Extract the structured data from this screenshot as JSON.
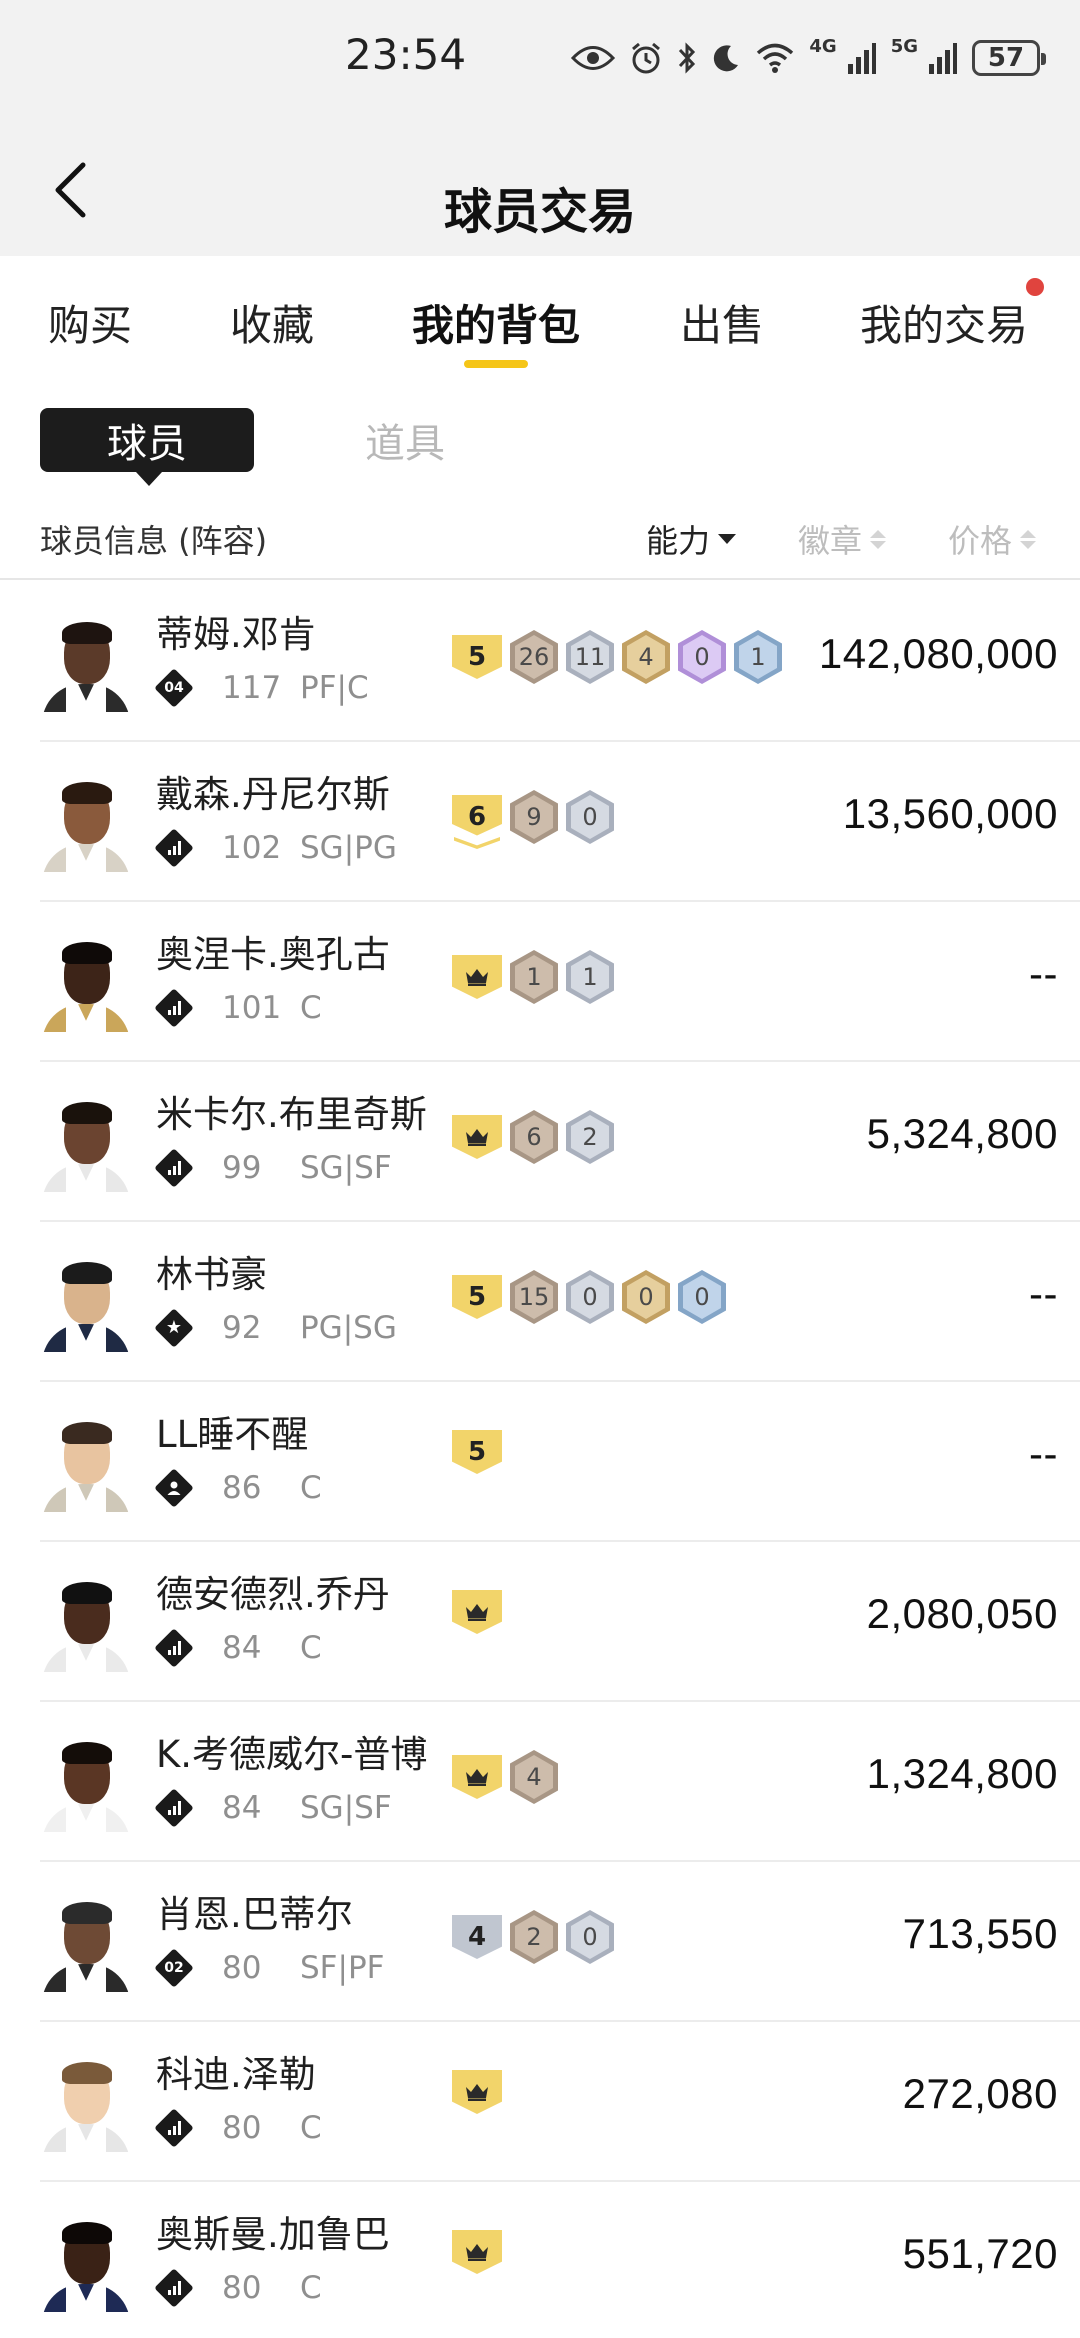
{
  "status_bar": {
    "time": "23:54",
    "net1": "4G",
    "net2": "5G",
    "battery": "57"
  },
  "nav": {
    "title": "球员交易"
  },
  "tabs": [
    {
      "label": "购买"
    },
    {
      "label": "收藏"
    },
    {
      "label": "我的背包"
    },
    {
      "label": "出售"
    },
    {
      "label": "我的交易"
    }
  ],
  "segment": {
    "players": "球员",
    "items": "道具"
  },
  "columns": {
    "info": "球员信息 (阵容)",
    "ability": "能力",
    "badge": "徽章",
    "price": "价格"
  },
  "colors": {
    "accent": "#f5c518",
    "notify_dot": "#e0443e",
    "level_gold": "#f2d46a"
  },
  "players": [
    {
      "name": "蒂姆.邓肯",
      "tier": "04",
      "rating": "117",
      "position": "PF|C",
      "level": "5",
      "badges": [
        "26",
        "11",
        "4",
        "0",
        "1"
      ],
      "price": "142,080,000"
    },
    {
      "name": "戴森.丹尼尔斯",
      "tier_icon": "bars-icon",
      "rating": "102",
      "position": "SG|PG",
      "level": "6",
      "badges": [
        "9",
        "0"
      ],
      "price": "13,560,000"
    },
    {
      "name": "奥涅卡.奥孔古",
      "tier_icon": "bars-icon",
      "rating": "101",
      "position": "C",
      "level_icon": "crown-icon",
      "badges": [
        "1",
        "1"
      ],
      "price": "--"
    },
    {
      "name": "米卡尔.布里奇斯",
      "tier_icon": "bars-icon",
      "rating": "99",
      "position": "SG|SF",
      "level_icon": "crown-icon",
      "badges": [
        "6",
        "2"
      ],
      "price": "5,324,800"
    },
    {
      "name": "林书豪",
      "tier_icon": "star-icon",
      "rating": "92",
      "position": "PG|SG",
      "level": "5",
      "badges": [
        "15",
        "0",
        "0",
        "0"
      ],
      "price": "--"
    },
    {
      "name": "LL睡不醒",
      "tier_icon": "person-icon",
      "rating": "86",
      "position": "C",
      "level": "5",
      "badges": [],
      "price": "--"
    },
    {
      "name": "德安德烈.乔丹",
      "tier_icon": "bars-icon",
      "rating": "84",
      "position": "C",
      "level_icon": "crown-icon",
      "badges": [],
      "price": "2,080,050"
    },
    {
      "name": "K.考德威尔-普博",
      "tier_icon": "bars-icon",
      "rating": "84",
      "position": "SG|SF",
      "level_icon": "crown-icon",
      "badges": [
        "4"
      ],
      "price": "1,324,800"
    },
    {
      "name": "肖恩.巴蒂尔",
      "tier": "02",
      "rating": "80",
      "position": "SF|PF",
      "level": "4",
      "badges": [
        "2",
        "0"
      ],
      "price": "713,550"
    },
    {
      "name": "科迪.泽勒",
      "tier_icon": "bars-icon",
      "rating": "80",
      "position": "C",
      "level_icon": "crown-icon",
      "badges": [],
      "price": "272,080"
    },
    {
      "name": "奥斯曼.加鲁巴",
      "tier_icon": "bars-icon",
      "rating": "80",
      "position": "C",
      "level_icon": "crown-icon",
      "badges": [],
      "price": "551,720"
    }
  ]
}
